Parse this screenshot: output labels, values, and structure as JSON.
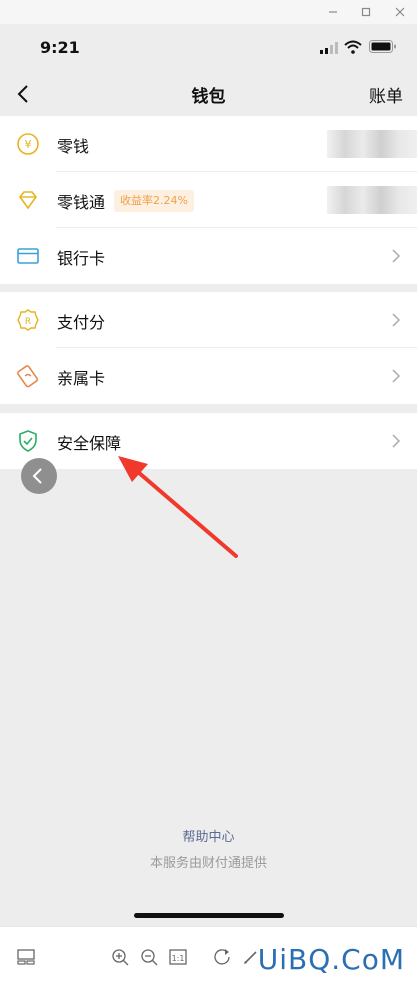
{
  "window": {
    "minimize_icon": "minimize-icon",
    "maximize_icon": "maximize-icon",
    "close_icon": "close-icon"
  },
  "status_bar": {
    "time": "9:21"
  },
  "nav": {
    "title": "钱包",
    "right_label": "账单"
  },
  "groups": [
    {
      "items": [
        {
          "label": "零钱",
          "icon": "coin-yen-icon"
        },
        {
          "label": "零钱通",
          "icon": "diamond-icon",
          "badge": "收益率2.24%"
        },
        {
          "label": "银行卡",
          "icon": "bank-card-icon"
        }
      ]
    },
    {
      "items": [
        {
          "label": "支付分",
          "icon": "score-badge-icon"
        },
        {
          "label": "亲属卡",
          "icon": "family-card-icon"
        }
      ]
    },
    {
      "items": [
        {
          "label": "安全保障",
          "icon": "shield-check-icon"
        }
      ]
    }
  ],
  "footer": {
    "help_link": "帮助中心",
    "provider_note": "本服务由财付通提供"
  },
  "watermark": "UiBQ.CoM",
  "colors": {
    "accent_link": "#5b6a91",
    "badge_text": "#f0a04b",
    "annotation_arrow": "#f0392b"
  }
}
